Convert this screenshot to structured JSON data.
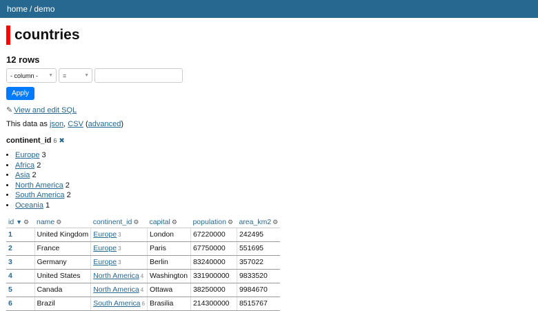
{
  "breadcrumb": {
    "home": "home",
    "separator": "/",
    "db": "demo"
  },
  "title": "countries",
  "row_count": "12 rows",
  "filter": {
    "column_placeholder": "- column -",
    "operator": "=",
    "value": ""
  },
  "apply_label": "Apply",
  "sql_link": "View and edit SQL",
  "export": {
    "prefix": "This data as",
    "json": "json",
    "comma": ",",
    "csv": "CSV",
    "open": "(",
    "advanced": "advanced",
    "close": ")"
  },
  "facet": {
    "name": "continent_id",
    "count": "6",
    "items": [
      {
        "label": "Europe",
        "count": "3"
      },
      {
        "label": "Africa",
        "count": "2"
      },
      {
        "label": "Asia",
        "count": "2"
      },
      {
        "label": "North America",
        "count": "2"
      },
      {
        "label": "South America",
        "count": "2"
      },
      {
        "label": "Oceania",
        "count": "1"
      }
    ]
  },
  "table": {
    "columns": [
      "id",
      "name",
      "continent_id",
      "capital",
      "population",
      "area_km2"
    ],
    "rows": [
      {
        "id": "1",
        "name": "United Kingdom",
        "continent": "Europe",
        "continent_id": "3",
        "capital": "London",
        "population": "67220000",
        "area": "242495"
      },
      {
        "id": "2",
        "name": "France",
        "continent": "Europe",
        "continent_id": "3",
        "capital": "Paris",
        "population": "67750000",
        "area": "551695"
      },
      {
        "id": "3",
        "name": "Germany",
        "continent": "Europe",
        "continent_id": "3",
        "capital": "Berlin",
        "population": "83240000",
        "area": "357022"
      },
      {
        "id": "4",
        "name": "United States",
        "continent": "North America",
        "continent_id": "4",
        "capital": "Washington",
        "population": "331900000",
        "area": "9833520"
      },
      {
        "id": "5",
        "name": "Canada",
        "continent": "North America",
        "continent_id": "4",
        "capital": "Ottawa",
        "population": "38250000",
        "area": "9984670"
      },
      {
        "id": "6",
        "name": "Brazil",
        "continent": "South America",
        "continent_id": "6",
        "capital": "Brasilia",
        "population": "214300000",
        "area": "8515767"
      }
    ]
  },
  "colors": {
    "topbar": "#276890",
    "accent_bar": "#ff0000",
    "link": "#276890",
    "button": "#007bff"
  },
  "icons": {
    "gear": "gear-icon",
    "sort": "sort-descending-icon",
    "remove": "close-icon",
    "edit": "pencil-icon",
    "dropdown": "chevron-down-icon"
  }
}
